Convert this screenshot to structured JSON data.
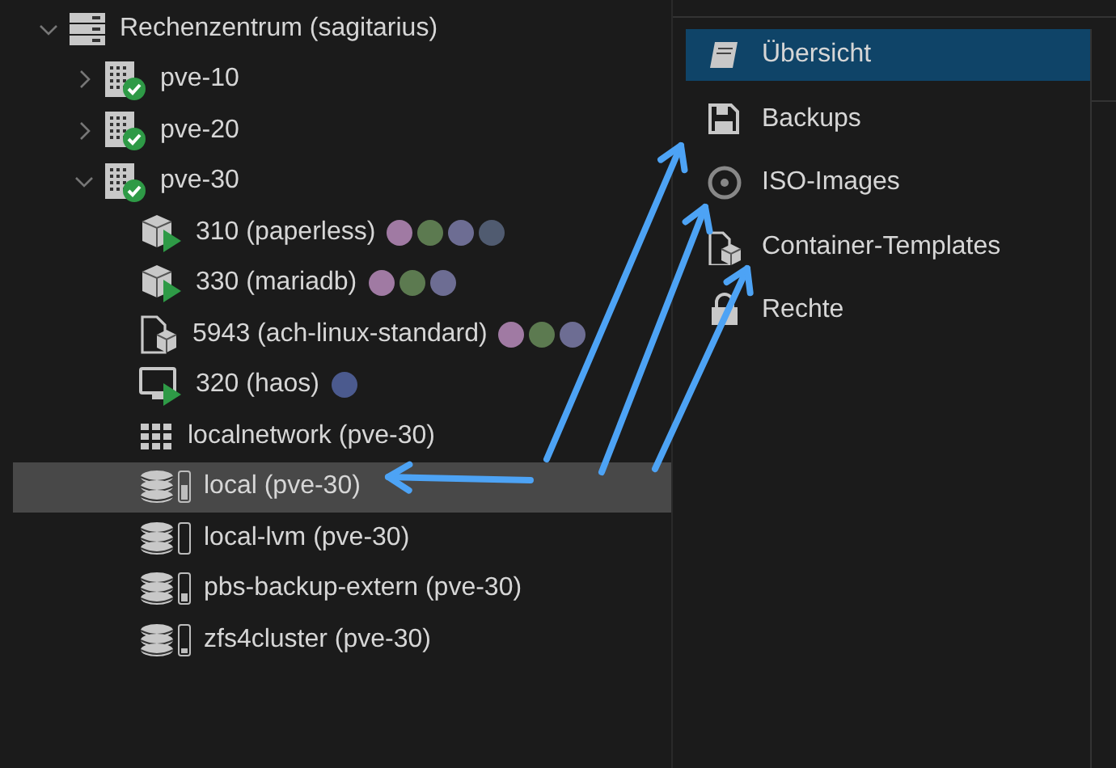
{
  "tree": {
    "label": "Rechenzentrum (sagitarius)",
    "kind": "datacenter",
    "expanded": true,
    "selected": false,
    "children": [
      {
        "label": "pve-10",
        "kind": "node",
        "online": true,
        "expanded": false,
        "selected": false
      },
      {
        "label": "pve-20",
        "kind": "node",
        "online": true,
        "expanded": false,
        "selected": false
      },
      {
        "label": "pve-30",
        "kind": "node",
        "online": true,
        "expanded": true,
        "selected": false,
        "children": [
          {
            "label": "310 (paperless)",
            "kind": "container",
            "running": true,
            "selected": false,
            "tags": [
              {
                "color": "#a07aa3"
              },
              {
                "color": "#5c7a50"
              },
              {
                "color": "#6d6d93"
              },
              {
                "color": "#505b70"
              }
            ]
          },
          {
            "label": "330 (mariadb)",
            "kind": "container",
            "running": true,
            "selected": false,
            "tags": [
              {
                "color": "#a07aa3"
              },
              {
                "color": "#5c7a50"
              },
              {
                "color": "#6d6d93"
              }
            ]
          },
          {
            "label": "5943 (ach-linux-standard)",
            "kind": "template",
            "selected": false,
            "tags": [
              {
                "color": "#a07aa3"
              },
              {
                "color": "#5c7a50"
              },
              {
                "color": "#6d6d93"
              }
            ]
          },
          {
            "label": "320 (haos)",
            "kind": "vm",
            "running": true,
            "selected": false,
            "tags": [
              {
                "color": "#4b5a8e"
              }
            ]
          },
          {
            "label": "localnetwork (pve-30)",
            "kind": "network",
            "selected": false
          },
          {
            "label": "local (pve-30)",
            "kind": "storage",
            "level": 0.6,
            "selected": true
          },
          {
            "label": "local-lvm (pve-30)",
            "kind": "storage",
            "level": 0,
            "selected": false
          },
          {
            "label": "pbs-backup-extern (pve-30)",
            "kind": "storage",
            "level": 0.35,
            "selected": false
          },
          {
            "label": "zfs4cluster (pve-30)",
            "kind": "storage",
            "level": 0.15,
            "selected": false
          }
        ]
      }
    ]
  },
  "menu": {
    "items": [
      {
        "label": "Übersicht",
        "kind": "summary",
        "selected": true
      },
      {
        "label": "Backups",
        "kind": "backup",
        "selected": false
      },
      {
        "label": "ISO-Images",
        "kind": "iso",
        "selected": false
      },
      {
        "label": "Container-Templates",
        "kind": "template",
        "selected": false
      },
      {
        "label": "Rechte",
        "kind": "permissions",
        "selected": false
      }
    ]
  }
}
